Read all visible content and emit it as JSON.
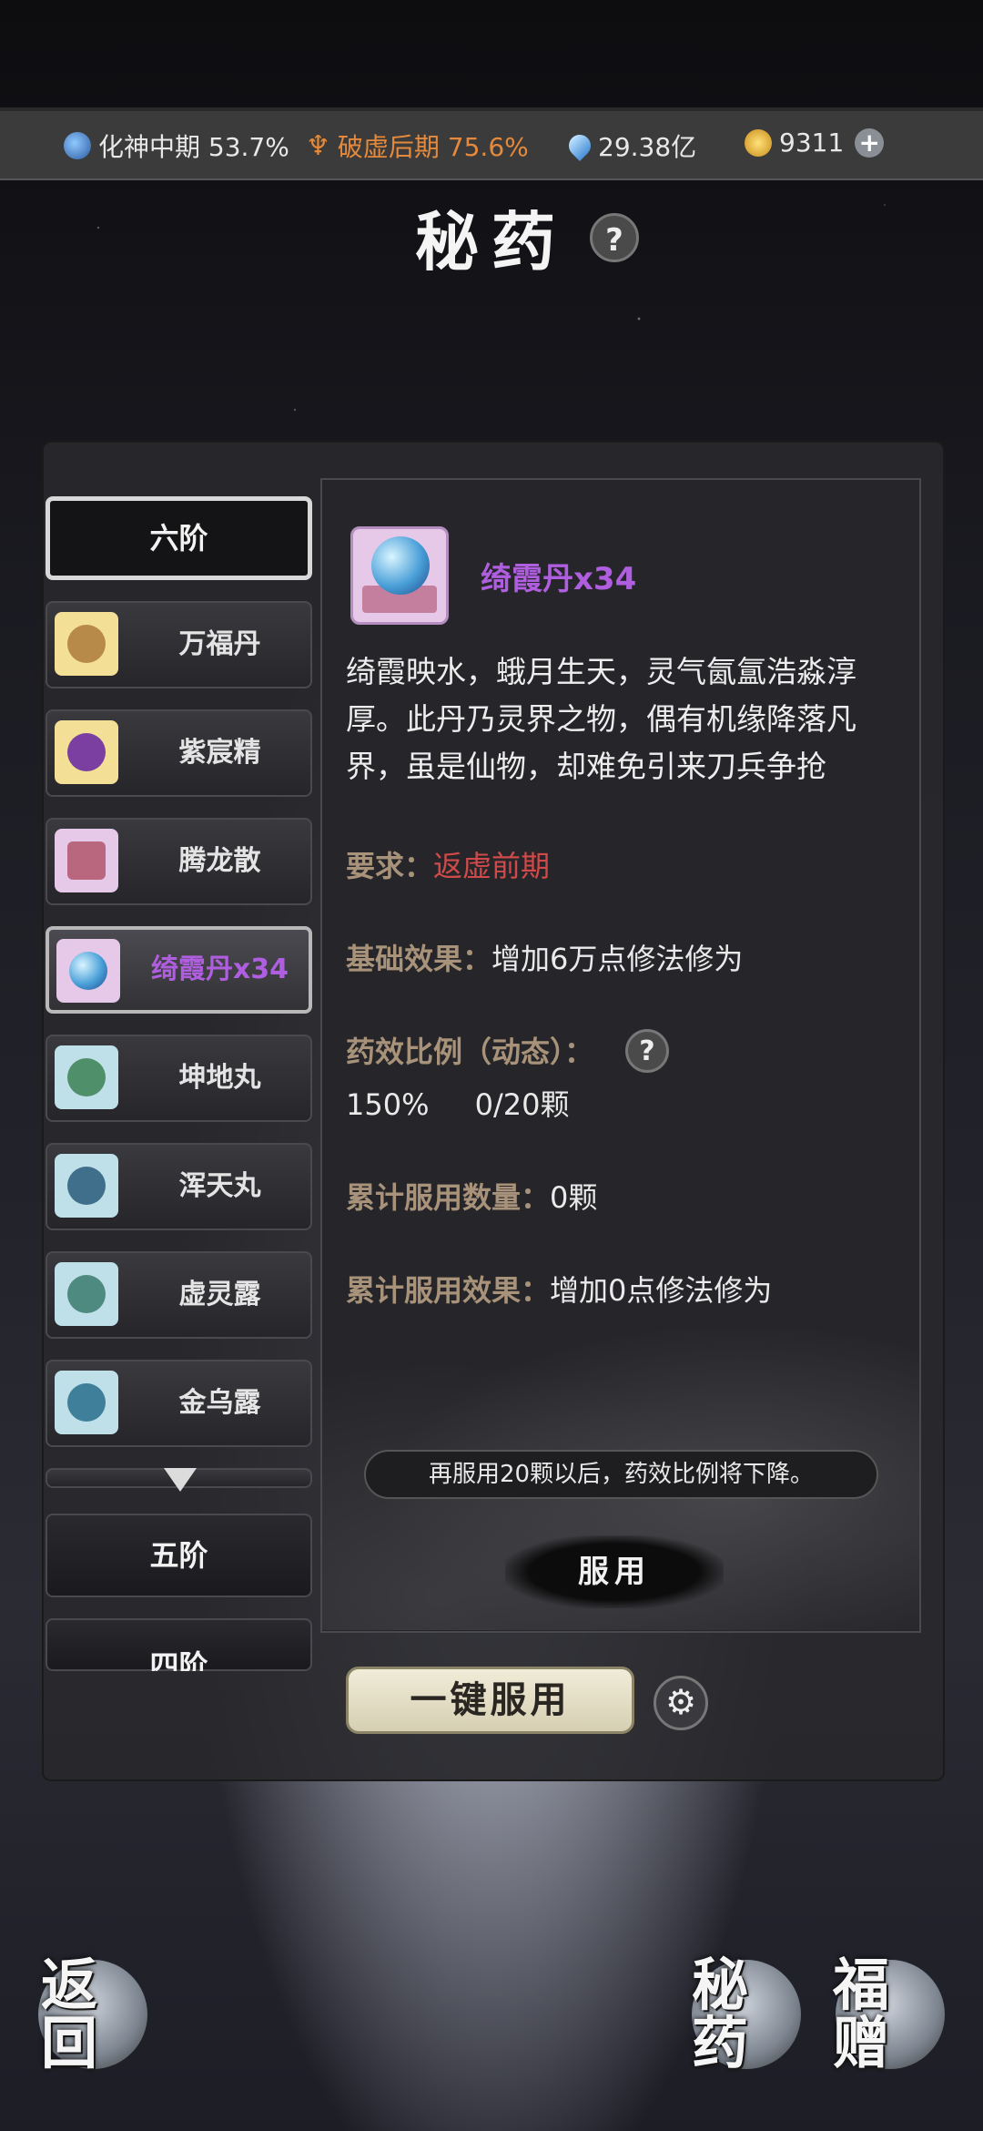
{
  "topbar": {
    "stat1": {
      "label": "化神中期 53.7%",
      "icon": "yin-yang-icon"
    },
    "stat2": {
      "label": "破虚后期 75.6%",
      "icon": "trident-icon",
      "color": "#e58a3c"
    },
    "stat3": {
      "label": "29.38亿",
      "icon": "spirit-drop-icon"
    },
    "stat4": {
      "label": "9311",
      "icon": "gold-coin-icon"
    }
  },
  "header": {
    "title": "秘药",
    "help": "?"
  },
  "tiers": {
    "six": "六阶",
    "five": "五阶",
    "four": "四阶"
  },
  "items": [
    {
      "name": "万福丹",
      "thumb_bg": "#f3df95",
      "thumb_color": "#b88a4a"
    },
    {
      "name": "紫宸精",
      "thumb_bg": "#f3df95",
      "thumb_color": "#7a3fa0"
    },
    {
      "name": "腾龙散",
      "thumb_bg": "#e6c9e9",
      "thumb_color": "#b8677f"
    },
    {
      "name": "绮霞丹x34",
      "thumb_bg": "#e6c9e9",
      "thumb_color": "#4a9fd8"
    },
    {
      "name": "坤地丸",
      "thumb_bg": "#bfe0e8",
      "thumb_color": "#4f8f6a"
    },
    {
      "name": "浑天丸",
      "thumb_bg": "#bfe0e8",
      "thumb_color": "#3f6f8a"
    },
    {
      "name": "虚灵露",
      "thumb_bg": "#bfe0e8",
      "thumb_color": "#4f8a80"
    },
    {
      "name": "金乌露",
      "thumb_bg": "#bfe0e8",
      "thumb_color": "#3f7f9a"
    }
  ],
  "detail": {
    "name": "绮霞丹x34",
    "description": "绮霞映水，蛾月生天，灵气氤氲浩淼淳厚。此丹乃灵界之物，偶有机缘降落凡界，虽是仙物，却难免引来刀兵争抢",
    "requirement_key": "要求：",
    "requirement_value": "返虚前期",
    "base_key": "基础效果：",
    "base_value": "增加6万点修法修为",
    "ratio_key": "药效比例（动态）：",
    "ratio_help": "?",
    "ratio_value": "150%",
    "ratio_count": "0/20颗",
    "taken_key": "累计服用数量：",
    "taken_value": "0颗",
    "taken_effect_key": "累计服用效果：",
    "taken_effect_value": "增加0点修法修为",
    "notice": "再服用20颗以后，药效比例将下降。",
    "use_button": "服用"
  },
  "actions": {
    "one_click": "一键服用",
    "settings_icon": "gear-icon"
  },
  "bottom_nav": {
    "back": "返回",
    "secret_medicine": "秘药",
    "blessing": "福赠"
  }
}
